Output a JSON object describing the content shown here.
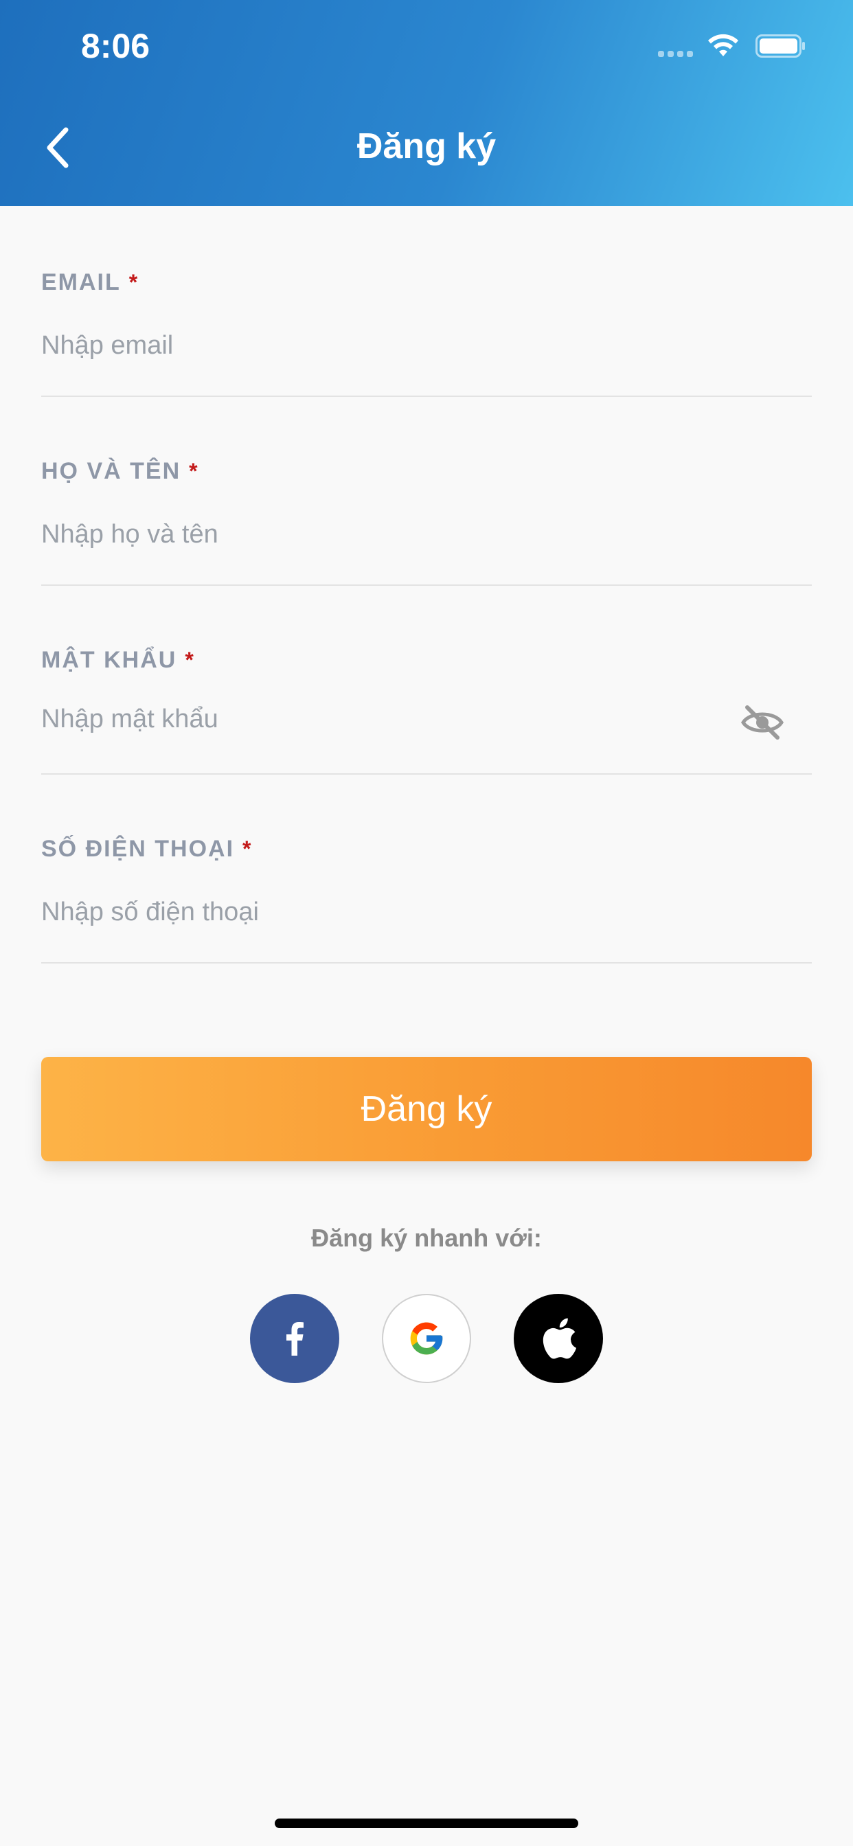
{
  "status_bar": {
    "time": "8:06"
  },
  "header": {
    "title": "Đăng ký",
    "back_icon": "chevron-left-icon"
  },
  "form": {
    "fields": [
      {
        "label": "EMAIL",
        "required_mark": "*",
        "placeholder": "Nhập email",
        "value": ""
      },
      {
        "label": "HỌ VÀ TÊN",
        "required_mark": "*",
        "placeholder": "Nhập họ và tên",
        "value": ""
      },
      {
        "label": "MẬT KHẨU",
        "required_mark": "*",
        "placeholder": "Nhập mật khẩu",
        "value": "",
        "toggle_icon": "eye-slash-icon"
      },
      {
        "label": "SỐ ĐIỆN THOẠI",
        "required_mark": "*",
        "placeholder": "Nhập số điện thoại",
        "value": ""
      }
    ],
    "submit_label": "Đăng ký"
  },
  "quick_signup": {
    "label": "Đăng ký nhanh với:",
    "providers": [
      {
        "name": "facebook",
        "icon": "facebook-icon",
        "color": "#3b5899"
      },
      {
        "name": "google",
        "icon": "google-icon",
        "color": "#ffffff"
      },
      {
        "name": "apple",
        "icon": "apple-icon",
        "color": "#000000"
      }
    ]
  },
  "colors": {
    "header_gradient_start": "#1e6fbd",
    "header_gradient_end": "#4cc0ee",
    "button_gradient_start": "#fdb347",
    "button_gradient_end": "#f6882b",
    "required_mark": "#c31a1a",
    "label": "#8e97a7"
  }
}
